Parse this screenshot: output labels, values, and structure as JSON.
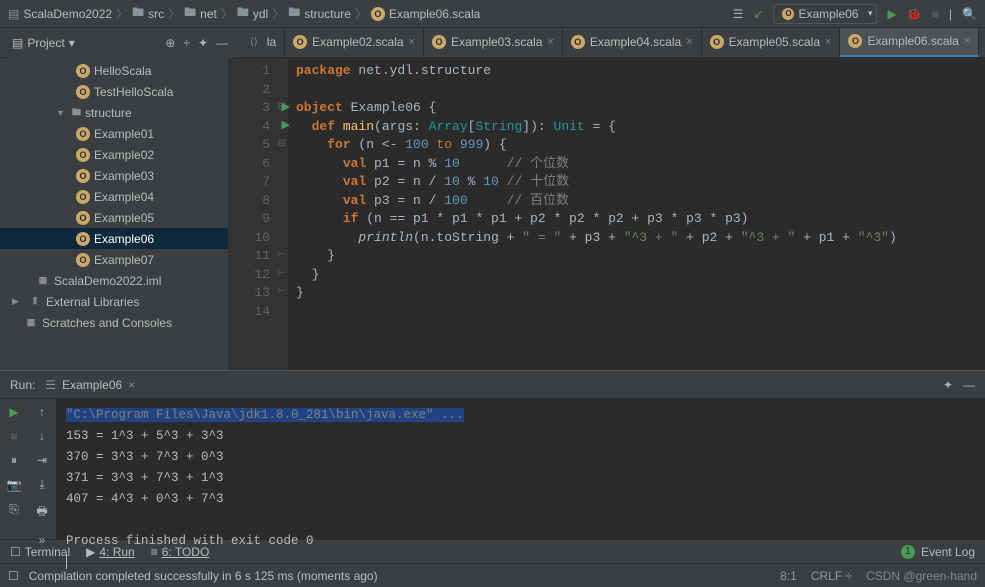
{
  "breadcrumb": [
    "ScalaDemo2022",
    "src",
    "net",
    "ydl",
    "structure",
    "Example06.scala"
  ],
  "runcfg": "Example06",
  "sidebar": {
    "items": [
      {
        "icon": "obj",
        "label": "HelloScala",
        "depth": 1
      },
      {
        "icon": "obj",
        "label": "TestHelloScala",
        "depth": 1
      },
      {
        "icon": "fold",
        "label": "structure",
        "depth": 0,
        "exp": "▼"
      },
      {
        "icon": "obj",
        "label": "Example01",
        "depth": 1
      },
      {
        "icon": "obj",
        "label": "Example02",
        "depth": 1
      },
      {
        "icon": "obj",
        "label": "Example03",
        "depth": 1
      },
      {
        "icon": "obj",
        "label": "Example04",
        "depth": 1
      },
      {
        "icon": "obj",
        "label": "Example05",
        "depth": 1
      },
      {
        "icon": "obj",
        "label": "Example06",
        "depth": 1,
        "sel": true
      },
      {
        "icon": "obj",
        "label": "Example07",
        "depth": 1
      },
      {
        "icon": "iml",
        "label": "ScalaDemo2022.iml",
        "depth": -1
      },
      {
        "icon": "lib",
        "label": "External Libraries",
        "depth": -2,
        "exp": "▶"
      },
      {
        "icon": "scr",
        "label": "Scratches and Consoles",
        "depth": -2
      }
    ]
  },
  "projectLabel": "Project",
  "tabs": [
    {
      "label": "la",
      "arrows": true
    },
    {
      "label": "Example02.scala"
    },
    {
      "label": "Example03.scala"
    },
    {
      "label": "Example04.scala"
    },
    {
      "label": "Example05.scala"
    },
    {
      "label": "Example06.scala",
      "active": true
    }
  ],
  "gutter": [
    "1",
    "2",
    "3",
    "4",
    "5",
    "6",
    "7",
    "8",
    "9",
    "10",
    "11",
    "12",
    "13",
    "14"
  ],
  "runpanel": {
    "title": "Run:",
    "tab": "Example06",
    "cmd": "\"C:\\Program Files\\Java\\jdk1.8.0_281\\bin\\java.exe\" ...",
    "lines": [
      "153 = 1^3 + 5^3 + 3^3",
      "370 = 3^3 + 7^3 + 0^3",
      "371 = 3^3 + 7^3 + 1^3",
      "407 = 4^3 + 0^3 + 7^3",
      "",
      "Process finished with exit code 0"
    ]
  },
  "bottombar": {
    "terminal": "Terminal",
    "run": "4: Run",
    "todo": "6: TODO",
    "event": "Event Log"
  },
  "status": {
    "msg": "Compilation completed successfully in 6 s 125 ms (moments ago)",
    "pos": "8:1",
    "enc": "CRLF",
    "watermark": "CSDN @green-hand"
  }
}
